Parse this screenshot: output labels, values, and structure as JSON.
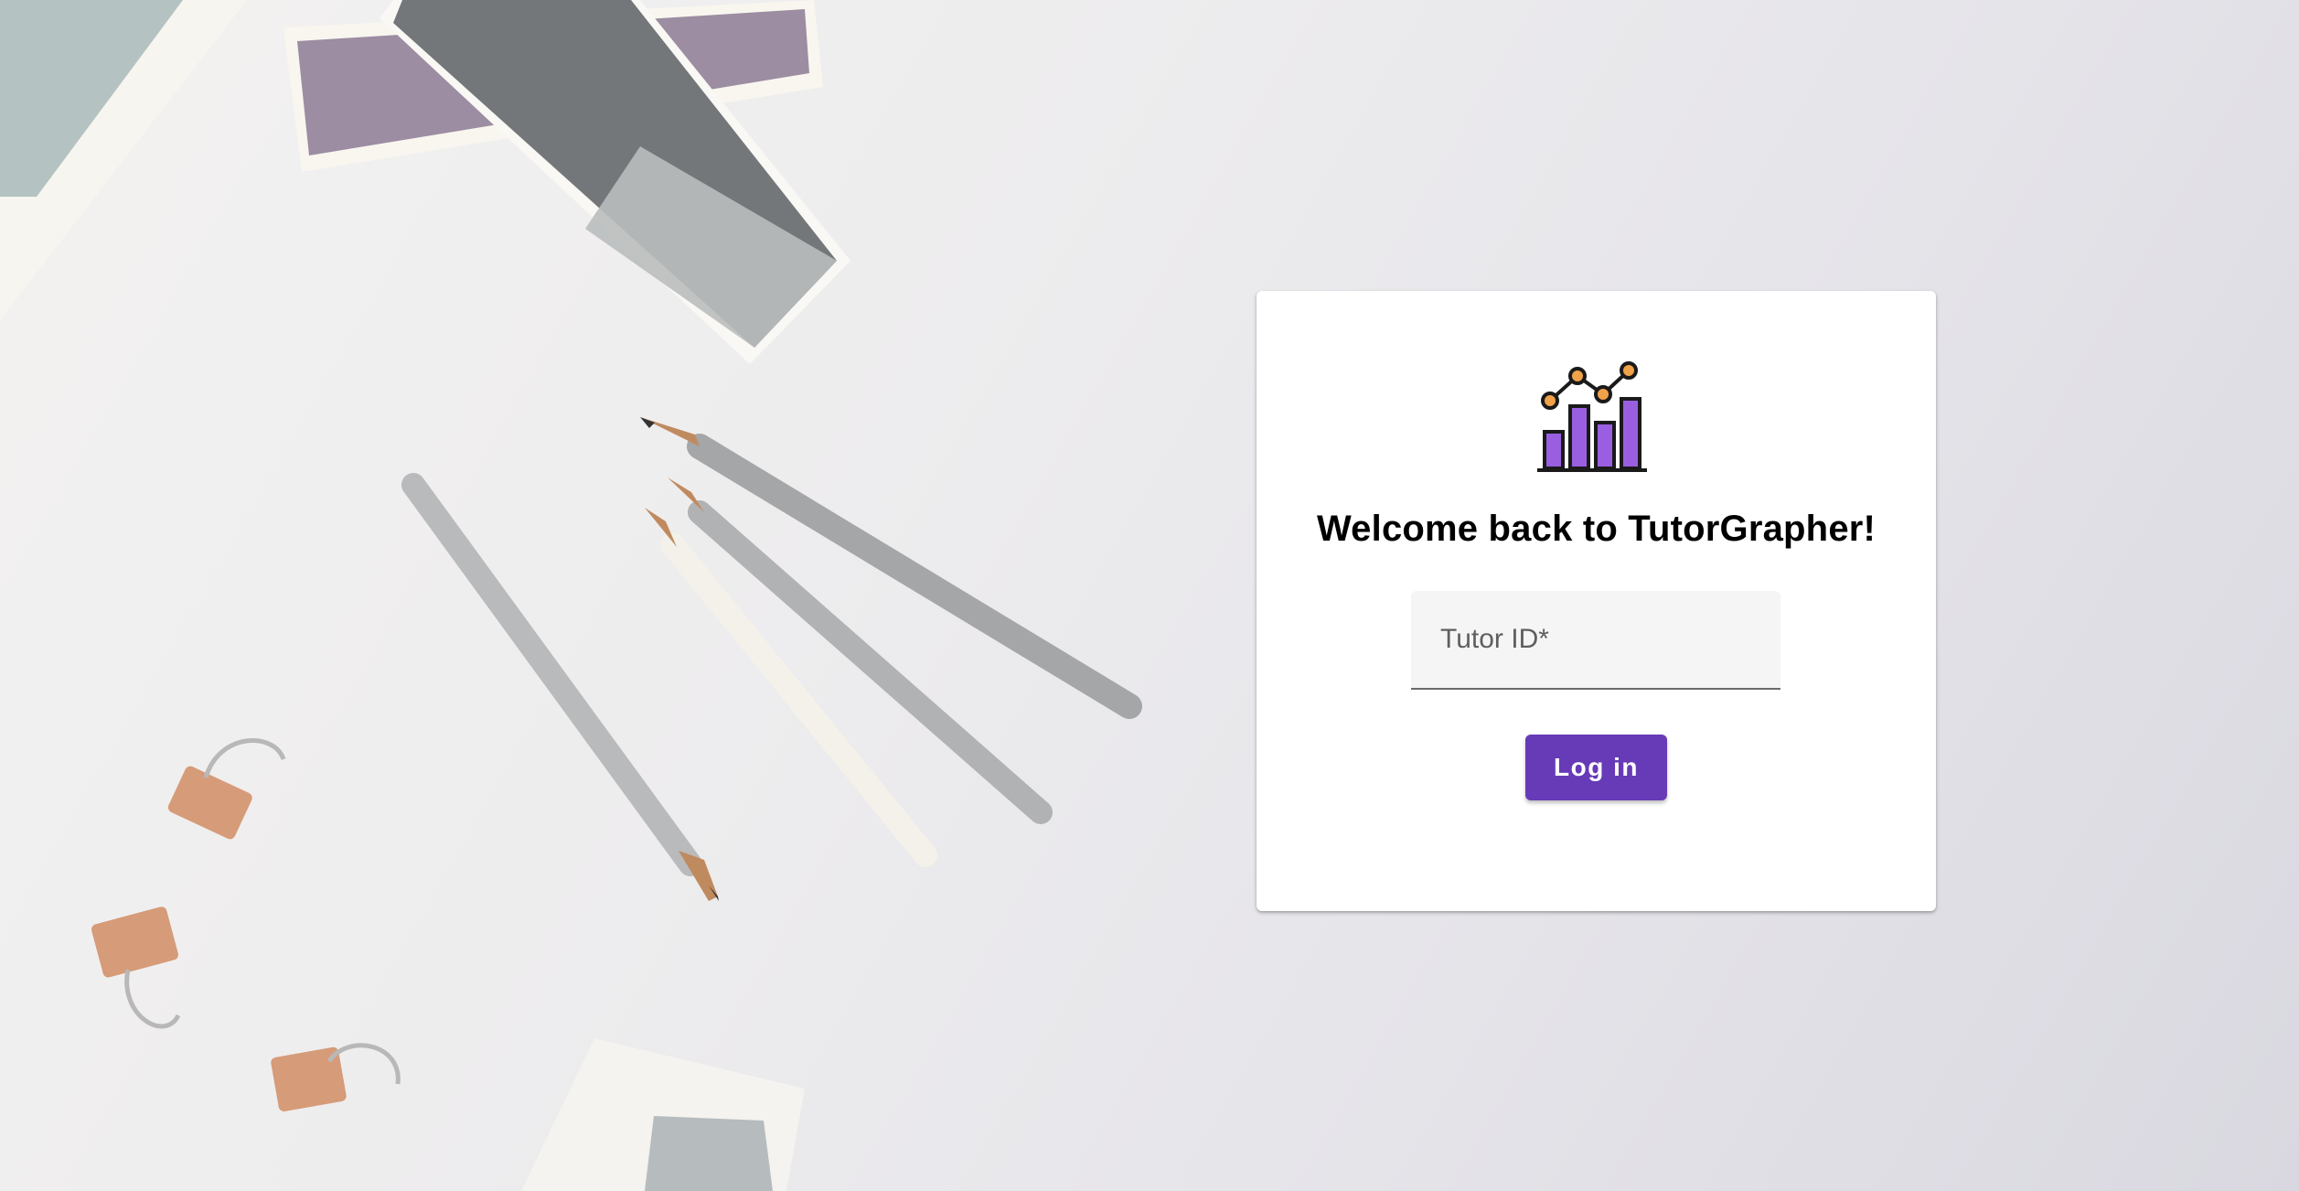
{
  "login": {
    "title": "Welcome back to TutorGrapher!",
    "tutor_id_placeholder": "Tutor ID*",
    "tutor_id_value": "",
    "login_label": "Log in"
  },
  "logo": {
    "icon": "bar-line-chart-icon"
  },
  "colors": {
    "accent": "#673ab7",
    "logo_bar": "#9a5fe0",
    "logo_dot": "#f0a24a",
    "card": "#ffffff"
  }
}
